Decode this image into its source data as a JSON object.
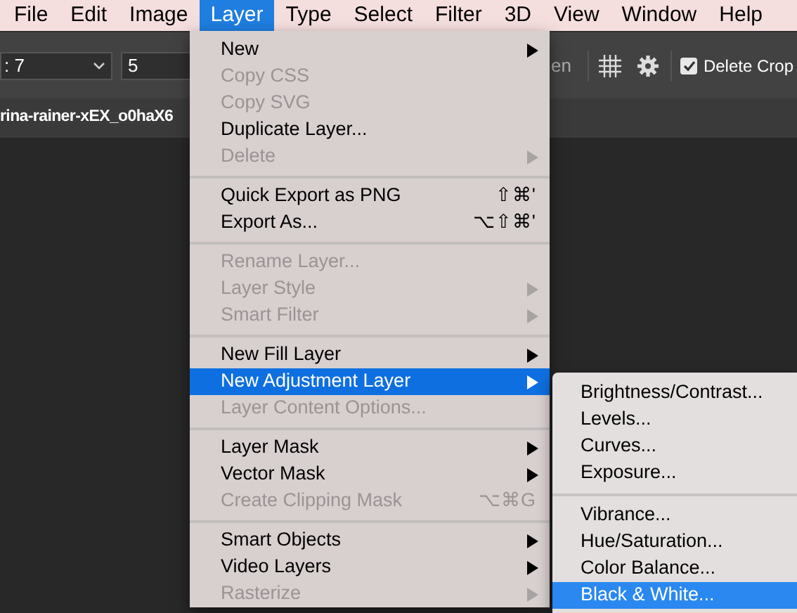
{
  "menu_bar": [
    {
      "label": "File",
      "selected": false
    },
    {
      "label": "Edit",
      "selected": false
    },
    {
      "label": "Image",
      "selected": false
    },
    {
      "label": "Layer",
      "selected": true
    },
    {
      "label": "Type",
      "selected": false
    },
    {
      "label": "Select",
      "selected": false
    },
    {
      "label": "Filter",
      "selected": false
    },
    {
      "label": "3D",
      "selected": false
    },
    {
      "label": "View",
      "selected": false
    },
    {
      "label": "Window",
      "selected": false
    },
    {
      "label": "Help",
      "selected": false
    }
  ],
  "options_bar": {
    "ratio": ": 7",
    "value": "5",
    "straighten": "en",
    "delete_cropped": {
      "label": "Delete Crop",
      "checked": true
    }
  },
  "document_tab": {
    "title": "rina-rainer-xEX_o0haX6"
  },
  "layer_menu": [
    {
      "kind": "item",
      "label": "New",
      "disabled": false,
      "submenu": true,
      "selected": false
    },
    {
      "kind": "item",
      "label": "Copy CSS",
      "disabled": true,
      "submenu": false,
      "selected": false
    },
    {
      "kind": "item",
      "label": "Copy SVG",
      "disabled": true,
      "submenu": false,
      "selected": false
    },
    {
      "kind": "item",
      "label": "Duplicate Layer...",
      "disabled": false,
      "submenu": false,
      "selected": false
    },
    {
      "kind": "item",
      "label": "Delete",
      "disabled": true,
      "submenu": true,
      "selected": false
    },
    {
      "kind": "separator"
    },
    {
      "kind": "item",
      "label": "Quick Export as PNG",
      "disabled": false,
      "submenu": false,
      "selected": false,
      "shortcut": "⇧⌘'"
    },
    {
      "kind": "item",
      "label": "Export As...",
      "disabled": false,
      "submenu": false,
      "selected": false,
      "shortcut": "⌥⇧⌘'"
    },
    {
      "kind": "separator"
    },
    {
      "kind": "item",
      "label": "Rename Layer...",
      "disabled": true,
      "submenu": false,
      "selected": false
    },
    {
      "kind": "item",
      "label": "Layer Style",
      "disabled": true,
      "submenu": true,
      "selected": false
    },
    {
      "kind": "item",
      "label": "Smart Filter",
      "disabled": true,
      "submenu": true,
      "selected": false
    },
    {
      "kind": "separator"
    },
    {
      "kind": "item",
      "label": "New Fill Layer",
      "disabled": false,
      "submenu": true,
      "selected": false
    },
    {
      "kind": "item",
      "label": "New Adjustment Layer",
      "disabled": false,
      "submenu": true,
      "selected": true
    },
    {
      "kind": "item",
      "label": "Layer Content Options...",
      "disabled": true,
      "submenu": false,
      "selected": false
    },
    {
      "kind": "separator"
    },
    {
      "kind": "item",
      "label": "Layer Mask",
      "disabled": false,
      "submenu": true,
      "selected": false
    },
    {
      "kind": "item",
      "label": "Vector Mask",
      "disabled": false,
      "submenu": true,
      "selected": false
    },
    {
      "kind": "item",
      "label": "Create Clipping Mask",
      "disabled": true,
      "submenu": false,
      "selected": false,
      "shortcut": "⌥⌘G"
    },
    {
      "kind": "separator"
    },
    {
      "kind": "item",
      "label": "Smart Objects",
      "disabled": false,
      "submenu": true,
      "selected": false
    },
    {
      "kind": "item",
      "label": "Video Layers",
      "disabled": false,
      "submenu": true,
      "selected": false
    },
    {
      "kind": "item",
      "label": "Rasterize",
      "disabled": true,
      "submenu": true,
      "selected": false
    }
  ],
  "adjustment_submenu": [
    {
      "kind": "item",
      "label": "Brightness/Contrast...",
      "selected": false
    },
    {
      "kind": "item",
      "label": "Levels...",
      "selected": false
    },
    {
      "kind": "item",
      "label": "Curves...",
      "selected": false
    },
    {
      "kind": "item",
      "label": "Exposure...",
      "selected": false
    },
    {
      "kind": "separator"
    },
    {
      "kind": "item",
      "label": "Vibrance...",
      "selected": false
    },
    {
      "kind": "item",
      "label": "Hue/Saturation...",
      "selected": false
    },
    {
      "kind": "item",
      "label": "Color Balance...",
      "selected": false
    },
    {
      "kind": "item",
      "label": "Black & White...",
      "selected": true
    }
  ]
}
